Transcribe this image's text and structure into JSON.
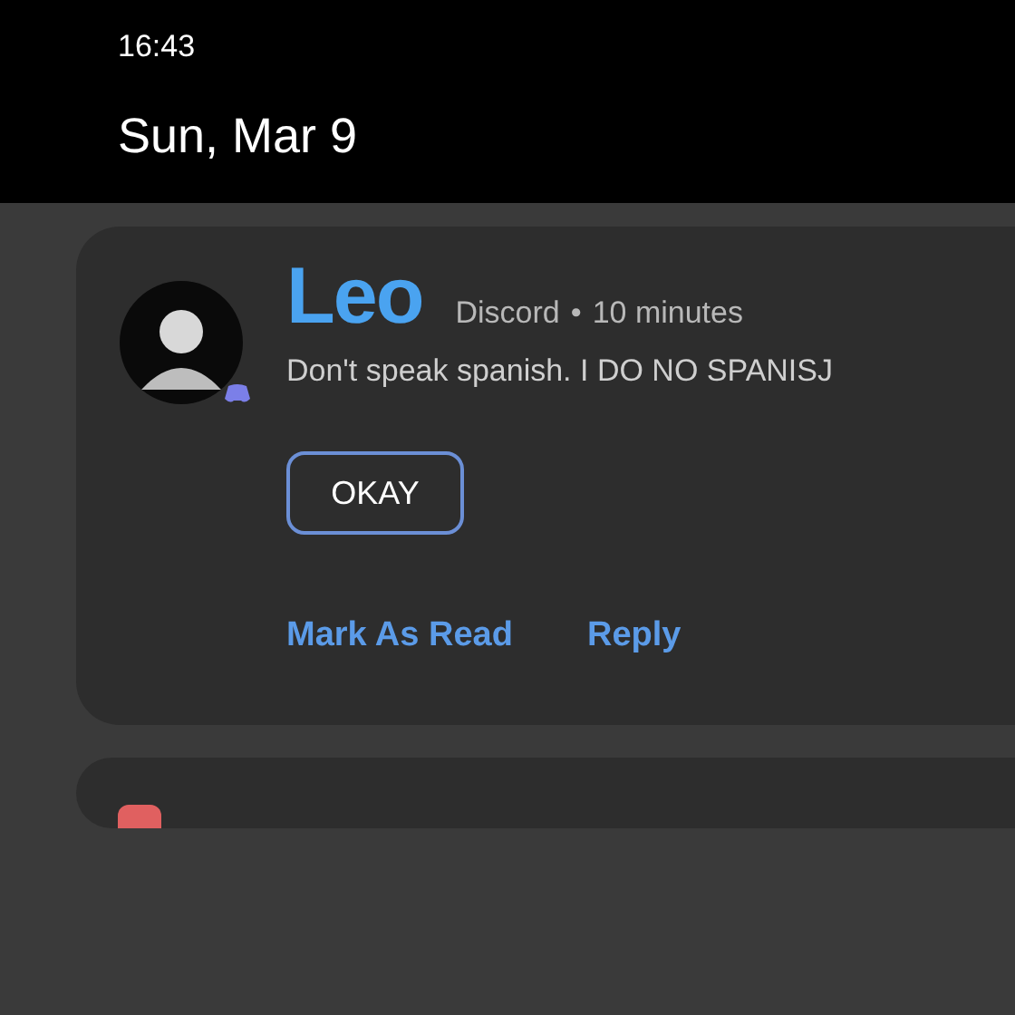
{
  "status_bar": {
    "time": "16:43",
    "date": "Sun, Mar 9"
  },
  "notifications": [
    {
      "kind": "message",
      "sender": "Leo",
      "app": "Discord",
      "separator": "•",
      "time": "10 minutes",
      "text": "Don't speak spanish. I DO NO SPANISJ",
      "buttons": [
        "OKAY"
      ],
      "actions": [
        "Mark As Read",
        "Reply"
      ]
    },
    {
      "kind": "collapsed"
    }
  ]
}
